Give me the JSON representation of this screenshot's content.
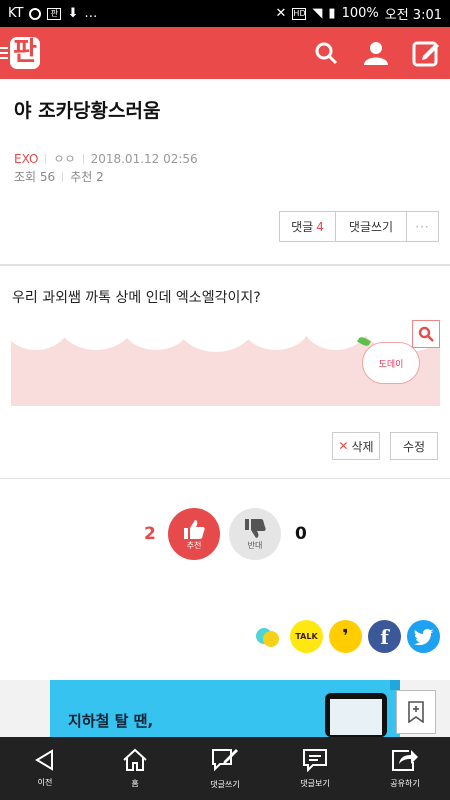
{
  "status_bar": {
    "carrier": "KT",
    "battery": "100%",
    "time": "오전 3:01",
    "hd": "HD"
  },
  "app": {
    "logo": "판"
  },
  "article": {
    "title": "야 조카당황스러움",
    "category": "EXO",
    "author": "ㅇㅇ",
    "datetime": "2018.01.12 02:56",
    "views_label": "조회",
    "views": "56",
    "recommend_label": "추천",
    "recommend": "2",
    "body": "우리 과외쌤 까톡 상메 인데 엑소엘각이지?"
  },
  "comment_buttons": {
    "comments_label": "댓글",
    "comments_count": "4",
    "write_label": "댓글쓰기",
    "more_label": "···"
  },
  "banner": {
    "brand": "도데이"
  },
  "post_actions": {
    "delete_label": "삭제",
    "edit_label": "수정"
  },
  "vote": {
    "up_count": "2",
    "up_label": "추천",
    "down_label": "반대",
    "down_count": "0"
  },
  "share": {
    "talk_label": "TALK"
  },
  "ad": {
    "text": "지하철 탈 땐,"
  },
  "nav": {
    "items": [
      "이전",
      "홈",
      "댓글쓰기",
      "댓글보기",
      "공유하기"
    ]
  },
  "colors": {
    "brand_red": "#ea4a4a",
    "accent_red": "#e64a4a",
    "nav_bg": "#222222"
  }
}
